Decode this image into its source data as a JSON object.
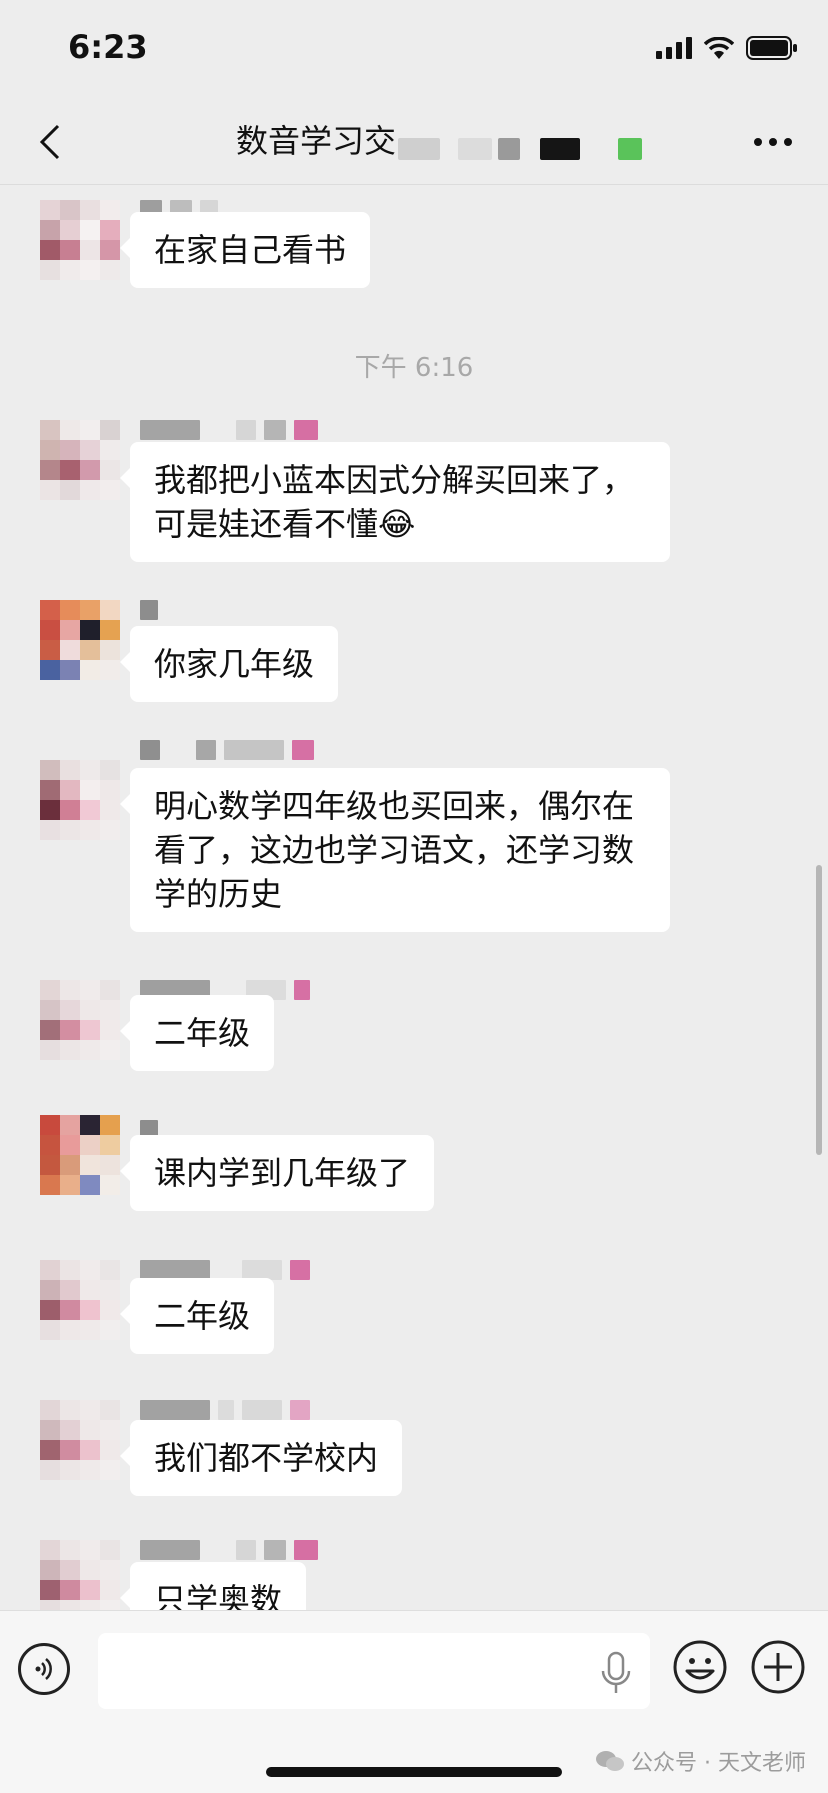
{
  "status_bar": {
    "time": "6:23"
  },
  "header": {
    "title": "数音学习交",
    "back_icon": "chevron-left-icon",
    "more_icon": "more-dots-icon"
  },
  "messages": [
    {
      "text": "在家自己看书"
    },
    {
      "text": "我都把小蓝本因式分解买回来了，可是娃还看不懂😂"
    },
    {
      "text": "你家几年级"
    },
    {
      "text": "明心数学四年级也买回来，偶尔在看了，这边也学习语文，还学习数学的历史"
    },
    {
      "text": "二年级"
    },
    {
      "text": "课内学到几年级了"
    },
    {
      "text": "二年级"
    },
    {
      "text": "我们都不学校内"
    },
    {
      "text": "只学奥数"
    }
  ],
  "time_divider": "下午 6:16",
  "input": {
    "placeholder": "",
    "value": ""
  },
  "watermark": "公众号 · 天文老师",
  "colors": {
    "background": "#ededed",
    "bubble": "#ffffff",
    "timestamp": "#a8a8a8"
  }
}
